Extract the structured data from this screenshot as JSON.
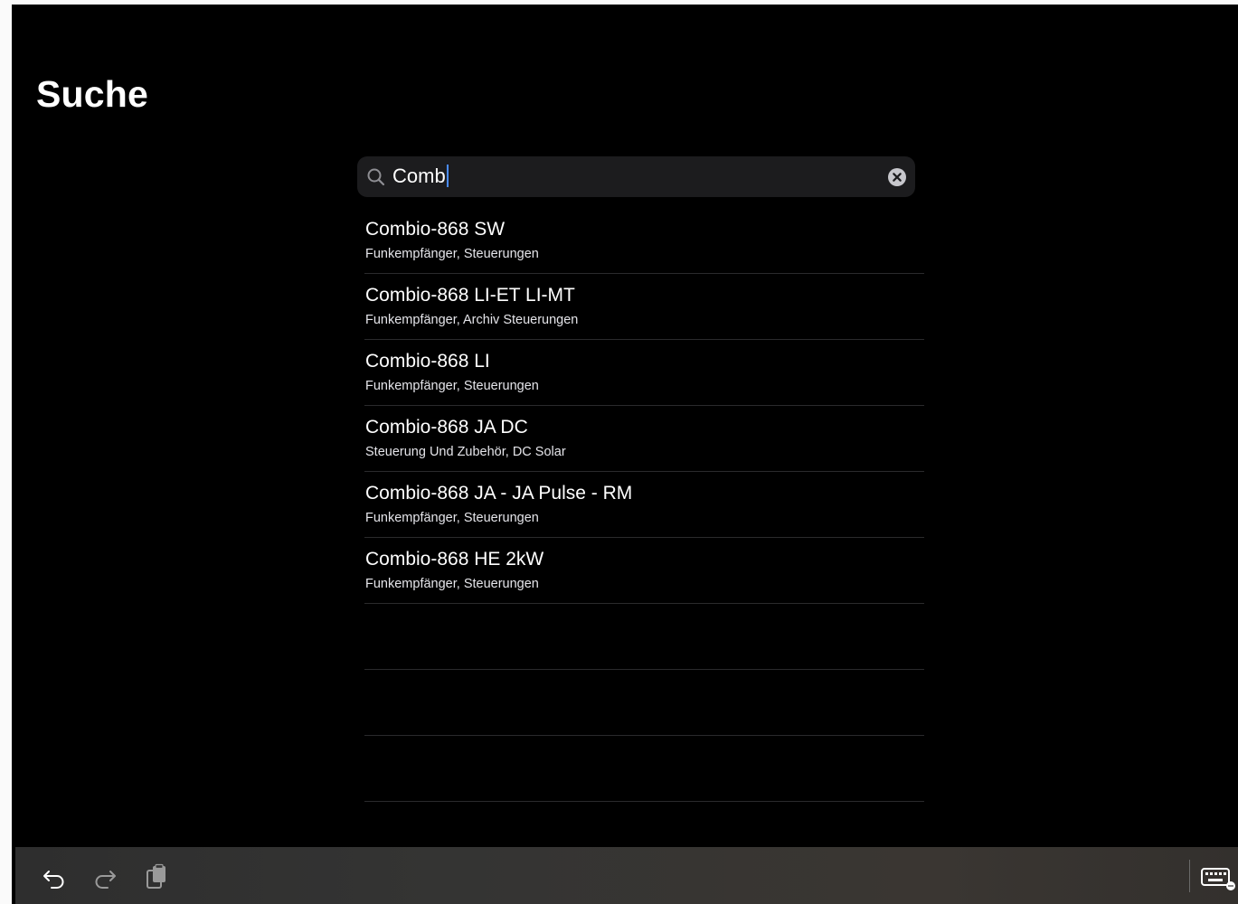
{
  "page": {
    "title": "Suche"
  },
  "search": {
    "query": "Comb",
    "search_icon": "magnifying-glass-icon",
    "clear_icon": "clear-circle-x-icon"
  },
  "results": [
    {
      "title": "Combio-868 SW",
      "subtitle": "Funkempfänger, Steuerungen"
    },
    {
      "title": "Combio-868 LI-ET LI-MT",
      "subtitle": "Funkempfänger, Archiv Steuerungen"
    },
    {
      "title": "Combio-868 LI",
      "subtitle": "Funkempfänger, Steuerungen"
    },
    {
      "title": "Combio-868 JA DC",
      "subtitle": "Steuerung Und Zubehör, DC Solar"
    },
    {
      "title": "Combio-868 JA - JA Pulse - RM",
      "subtitle": "Funkempfänger, Steuerungen"
    },
    {
      "title": "Combio-868 HE 2kW",
      "subtitle": "Funkempfänger, Steuerungen"
    }
  ],
  "toolbar": {
    "undo_icon": "undo-icon",
    "redo_icon": "redo-icon",
    "paste_icon": "clipboard-paste-icon",
    "keyboard_icon": "keyboard-icon"
  },
  "colors": {
    "background": "#000000",
    "search_field": "#1c1c1e",
    "cursor": "#4a8cff",
    "separator": "#2a2a2c"
  }
}
